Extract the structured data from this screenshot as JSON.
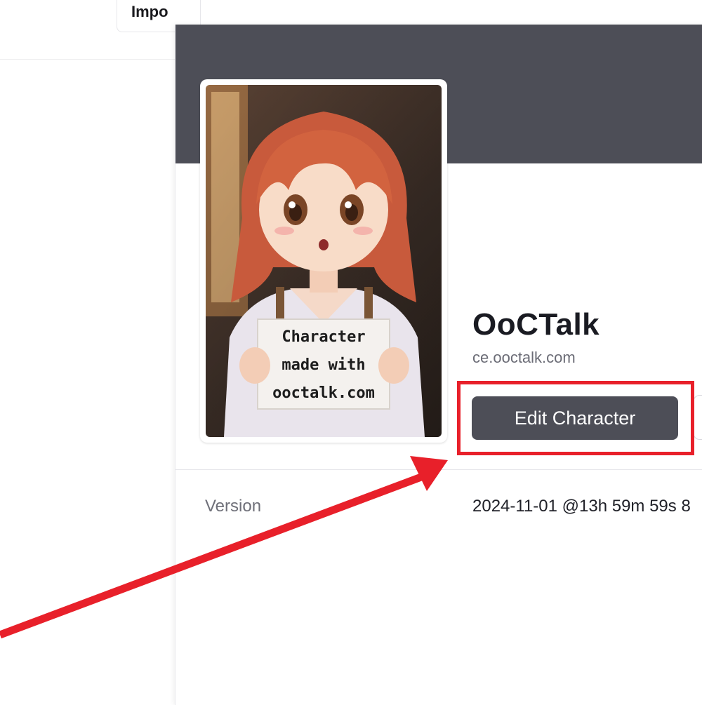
{
  "background_page": {
    "import_tab_label": "Impo"
  },
  "character": {
    "name": "OoCTalk",
    "site": "ce.ooctalk.com",
    "edit_button_label": "Edit Character",
    "avatar_sign_lines": [
      "Character",
      "made with",
      "ooctalk.com"
    ]
  },
  "details": {
    "version_label": "Version",
    "version_value": "2024-11-01 @13h 59m 59s 8"
  },
  "colors": {
    "banner": "#4d4e57",
    "button": "#4d4e57",
    "annotation": "#e8202a"
  }
}
